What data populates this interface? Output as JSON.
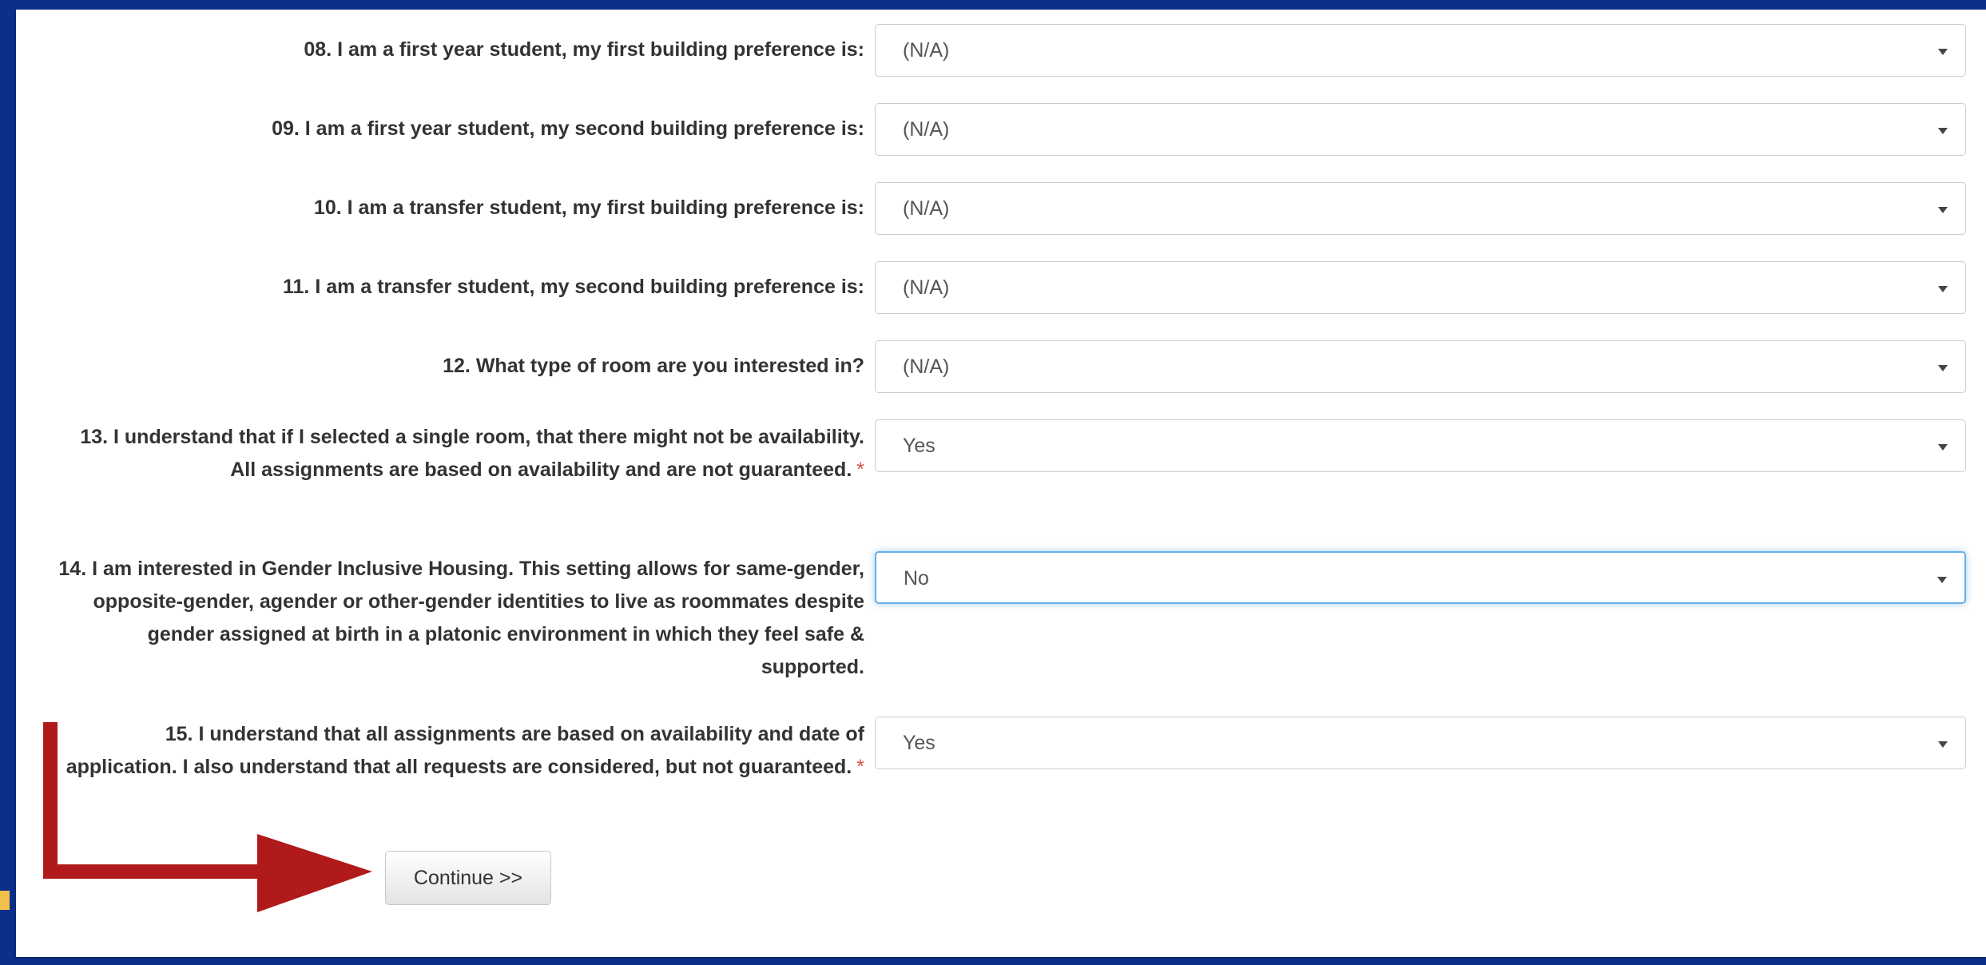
{
  "form": {
    "questions": [
      {
        "label": "08. I am a first year student, my first building preference is:",
        "value": "(N/A)",
        "required": ""
      },
      {
        "label": "09. I am a first year student, my second building preference is:",
        "value": "(N/A)",
        "required": ""
      },
      {
        "label": "10. I am a transfer student, my first building preference is:",
        "value": "(N/A)",
        "required": ""
      },
      {
        "label": "11. I am a transfer student, my second building preference is:",
        "value": "(N/A)",
        "required": ""
      },
      {
        "label": "12. What type of room are you interested in?",
        "value": "(N/A)",
        "required": ""
      },
      {
        "label": "13. I understand that if I selected a single room, that there might not be availability. All assignments are based on availability and are not guaranteed.",
        "value": "Yes",
        "required": "*"
      },
      {
        "label": "14. I am interested in Gender Inclusive Housing. This setting allows for same-gender, opposite-gender, agender or other-gender identities to live as roommates despite gender assigned at birth in a platonic environment in which they feel safe & supported.",
        "value": "No",
        "required": ""
      },
      {
        "label": "15. I understand that all assignments are based on availability and date of application. I also understand that all requests are considered, but not guaranteed.",
        "value": "Yes",
        "required": "*"
      }
    ],
    "continue_label": "Continue >>"
  },
  "colors": {
    "page_background": "#0b2f8a",
    "required_marker": "#d9534f",
    "focus_border": "#66afe9",
    "annotation_arrow": "#b01a1a"
  },
  "icons": {
    "select_caret": "caret-down-icon",
    "annotation": "arrow-right-icon"
  }
}
